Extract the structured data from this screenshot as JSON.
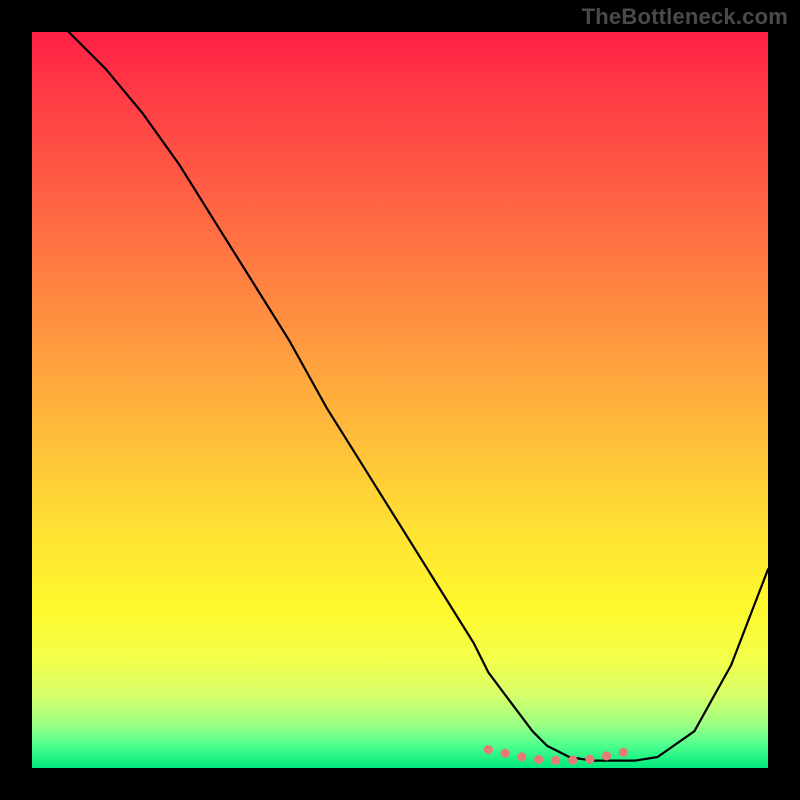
{
  "watermark": "TheBottleneck.com",
  "chart_data": {
    "type": "line",
    "title": "",
    "xlabel": "",
    "ylabel": "",
    "xlim": [
      0,
      100
    ],
    "ylim": [
      0,
      100
    ],
    "grid": false,
    "legend": false,
    "series": [
      {
        "name": "curve",
        "x": [
          5,
          10,
          15,
          20,
          25,
          30,
          35,
          40,
          45,
          50,
          55,
          60,
          62,
          65,
          68,
          70,
          73,
          76,
          78,
          80,
          82,
          85,
          90,
          95,
          100
        ],
        "y": [
          100,
          95,
          89,
          82,
          74,
          66,
          58,
          49,
          41,
          33,
          25,
          17,
          13,
          9,
          5,
          3,
          1.5,
          1,
          1,
          1,
          1,
          1.5,
          5,
          14,
          27
        ]
      }
    ],
    "highlight_band": {
      "note": "salmon dotted markers along valley floor",
      "x": [
        62,
        82
      ],
      "y": [
        1.3,
        1.3
      ]
    },
    "background_gradient": {
      "orientation": "vertical",
      "stops": [
        {
          "pos": 0.0,
          "color": "#ff2046"
        },
        {
          "pos": 0.2,
          "color": "#ff5a44"
        },
        {
          "pos": 0.44,
          "color": "#ff9e3f"
        },
        {
          "pos": 0.68,
          "color": "#ffe233"
        },
        {
          "pos": 0.85,
          "color": "#f3ff49"
        },
        {
          "pos": 1.0,
          "color": "#00e87e"
        }
      ]
    }
  }
}
